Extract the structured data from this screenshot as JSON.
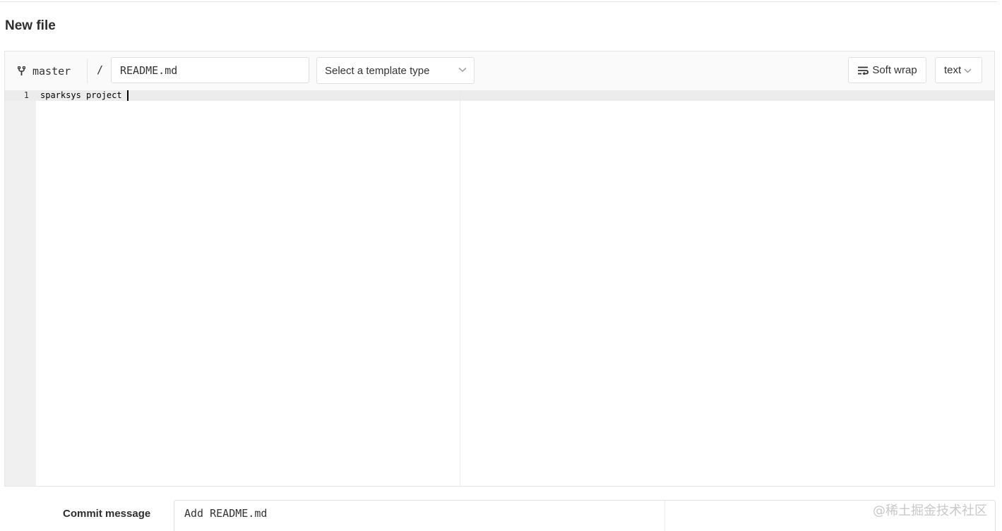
{
  "page": {
    "title": "New file"
  },
  "file_bar": {
    "branch_icon": "branch-icon",
    "branch": "master",
    "path_separator": "/",
    "file_name": "README.md",
    "template_select": {
      "selected": "Select a template type",
      "icon": "chevron-down-icon"
    },
    "soft_wrap": {
      "label": "Soft wrap",
      "icon": "soft-wrap-icon"
    },
    "mode_select": {
      "selected": "text",
      "icon": "chevron-down-icon"
    }
  },
  "editor": {
    "lines": [
      {
        "number": "1",
        "text": "sparksys project "
      }
    ]
  },
  "commit": {
    "label": "Commit message",
    "value": "Add README.md"
  },
  "watermark": "@稀土掘金技术社区",
  "colors": {
    "border": "#e5e5e5",
    "toolbar_bg": "#fafafa",
    "gutter_bg": "#f0f0f0"
  }
}
